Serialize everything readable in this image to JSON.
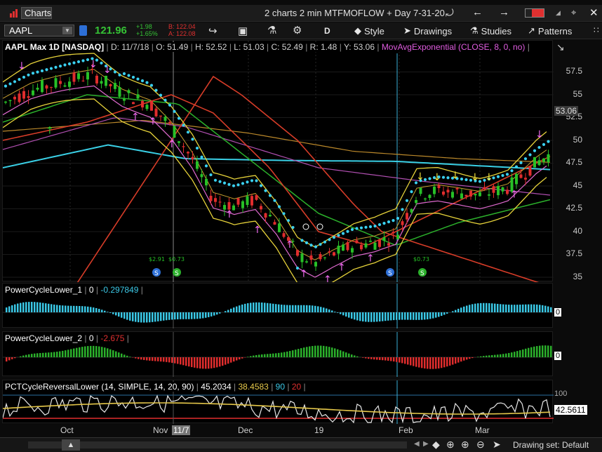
{
  "window": {
    "app_label": "Charts",
    "title": "2 charts 2 min MTFMOFLOW + Day 7-31-20"
  },
  "toolbar": {
    "symbol": "AAPL",
    "last_price": "121.96",
    "change": "+1.98",
    "change_pct": "+1.65%",
    "bid": "B: 122.04",
    "ask": "A: 122.08",
    "timeframe": "D",
    "style_label": "Style",
    "drawings_label": "Drawings",
    "studies_label": "Studies",
    "patterns_label": "Patterns",
    "colors": {
      "price": "#35c235",
      "change": "#35c235",
      "bidask": "#e03030"
    }
  },
  "price_pane": {
    "header": {
      "title": "AAPL Max 1D [NASDAQ]",
      "date": "D: 11/7/18",
      "open": "O: 51.49",
      "high": "H: 52.52",
      "low": "L: 51.03",
      "close": "C: 52.49",
      "range": "R: 1.48",
      "y": "Y: 53.06",
      "study": "MovAvgExponential (CLOSE, 8, 0, no)"
    },
    "ticks": [
      "57.5",
      "55",
      "52.5",
      "50",
      "47.5",
      "45",
      "42.5",
      "40",
      "37.5",
      "35"
    ],
    "last_tag": "53.06",
    "markers": [
      "$2.91",
      "$0.73",
      "$0.73"
    ]
  },
  "sub1": {
    "name": "PowerCycleLower_1",
    "zero": "0",
    "value": "-0.297849",
    "axis_zero": "0"
  },
  "sub2": {
    "name": "PowerCycleLower_2",
    "zero": "0",
    "value": "-2.675",
    "axis_zero": "0"
  },
  "sub3": {
    "name": "PCTCycleReversalLower (14, SIMPLE, 14, 20, 90)",
    "v1": "45.2034",
    "v2": "38.4583",
    "v3": "90",
    "v4": "20",
    "top_tick": "100",
    "last_tag": "42.5611"
  },
  "x_axis": {
    "labels": [
      "Oct",
      "Nov",
      "Dec",
      "19",
      "Feb",
      "Mar"
    ],
    "cursor_date": "11/7"
  },
  "status": {
    "drawing_set": "Drawing set: Default"
  }
}
